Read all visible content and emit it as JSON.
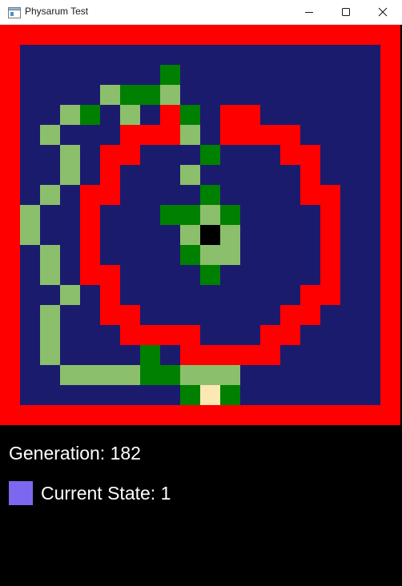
{
  "window": {
    "title": "Physarum Test",
    "icon": "app-window-icon",
    "controls": [
      "minimize-icon",
      "maximize-icon",
      "close-icon"
    ]
  },
  "grid": {
    "cols": 20,
    "rows": 20,
    "palette": {
      ".": "#1b1b6e",
      "R": "#ff0000",
      "G": "#008000",
      "L": "#8cbf6c",
      "K": "#000000",
      "C": "#fbe8b3"
    },
    "cells": [
      "RRRRRRRRRRRRRRRRRRRR",
      "R..................R",
      "R.......G..........R",
      "R....LGGL..........R",
      "R..LG.L.RG.RR......R",
      "R.L...RRRL.RRRR....R",
      "R..L.RR...G...RR...R",
      "R..L.R...L.....R...R",
      "R.L.RR....G....RR..R",
      "RL..R...GGLG....R..R",
      "RL..R....LKL....R..R",
      "R.L.R....GLL....R..R",
      "R.L.RR....G.....R..R",
      "R..L.R.........RR..R",
      "R.L..RR.......RR...R",
      "R.L...RRRR...RR....R",
      "R.L....G.RRRRR.....R",
      "R..LLLLGGLLL.......R",
      "R........GCG.......R",
      "RRRRRRRRRRRRRRRRRRRR"
    ]
  },
  "status": {
    "generation_label": "Generation: 182",
    "state_label": "Current State: 1",
    "state_color": "#7b68ee"
  }
}
